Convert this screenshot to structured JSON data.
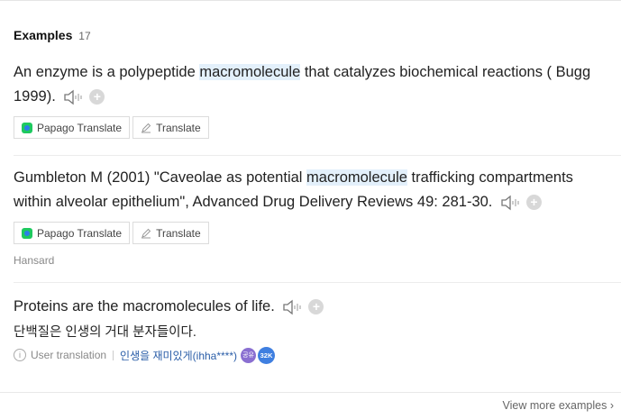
{
  "header": {
    "title": "Examples",
    "count": "17"
  },
  "examples": [
    {
      "pre": "An enzyme is a polypeptide ",
      "highlight": "macromolecule",
      "post": " that catalyzes biochemical reactions ( Bugg 1999).",
      "buttons": {
        "papago": "Papago Translate",
        "translate": "Translate"
      }
    },
    {
      "pre": "Gumbleton M (2001) \"Caveolae as potential ",
      "highlight": "macromolecule",
      "post": " trafficking compartments within alveolar epithelium\", Advanced Drug Delivery Reviews 49: 281-30.",
      "buttons": {
        "papago": "Papago Translate",
        "translate": "Translate"
      },
      "source": "Hansard"
    },
    {
      "text": "Proteins are the macromolecules of life.",
      "translation": "단백질은 인생의 거대 분자들이다.",
      "meta": {
        "label": "User translation",
        "user": "인생을 재미있게(ihha****)",
        "badge_level": "공유",
        "badge_count": "32K"
      }
    }
  ],
  "footer": {
    "view_more": "View more examples"
  },
  "colors": {
    "highlight": "#e3f0fb",
    "link": "#2b5ea8",
    "papago_green": "#1ec95f"
  },
  "icons": [
    "speaker-icon",
    "add-icon",
    "papago-icon",
    "pencil-icon",
    "info-icon",
    "chevron-right-icon"
  ]
}
